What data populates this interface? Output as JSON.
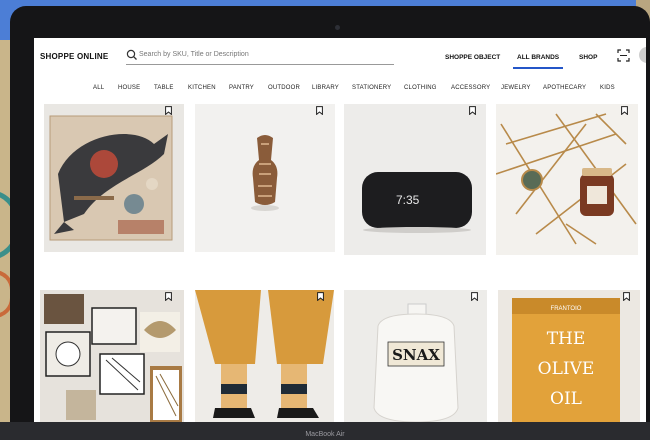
{
  "store": {
    "name": "SHOPPE ONLINE"
  },
  "search": {
    "placeholder": "Search by SKU, Title or Description"
  },
  "topnav": [
    {
      "label": "SHOPPE OBJECT"
    },
    {
      "label": "ALL BRANDS",
      "active": true
    },
    {
      "label": "SHOP"
    }
  ],
  "categories": [
    "ALL",
    "HOUSE",
    "TABLE",
    "KITCHEN",
    "PANTRY",
    "OUTDOOR",
    "LIBRARY",
    "STATIONERY",
    "CLOTHING",
    "ACCESSORY",
    "JEWELRY",
    "APOTHECARY",
    "KIDS"
  ],
  "products": [
    {
      "image": "whale-puzzle"
    },
    {
      "image": "wooden-bottle-opener"
    },
    {
      "image": "alarm-clock",
      "clock_text": "7:35"
    },
    {
      "image": "jewelry-candle-flatlay"
    },
    {
      "image": "ceramic-trays"
    },
    {
      "image": "striped-socks"
    },
    {
      "image": "snax-canister",
      "jar_text": "SNAX"
    },
    {
      "image": "olive-oil-tin",
      "tin_brand": "FRANTOIO",
      "tin_text_1": "THE",
      "tin_text_2": "OLIVE",
      "tin_text_3": "OIL"
    }
  ],
  "device": {
    "label": "MacBook Air"
  },
  "colors": {
    "accent": "#2456c8",
    "background_blue": "#4c7ed6",
    "olive_tin": "#e2a23a"
  }
}
